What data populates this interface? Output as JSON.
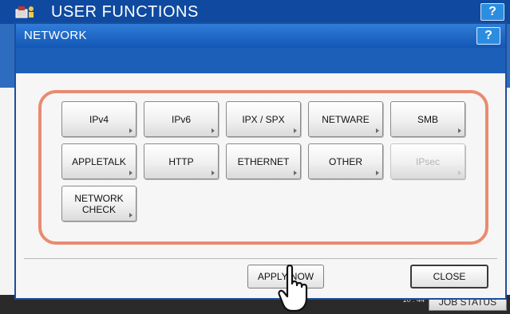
{
  "background": {
    "title": "USER FUNCTIONS",
    "help_label": "?",
    "time": "10 : 44",
    "job_status_label": "JOB STATUS"
  },
  "dialog": {
    "title": "NETWORK",
    "help_label": "?",
    "buttons": [
      {
        "label": "IPv4",
        "enabled": true
      },
      {
        "label": "IPv6",
        "enabled": true
      },
      {
        "label": "IPX / SPX",
        "enabled": true
      },
      {
        "label": "NETWARE",
        "enabled": true
      },
      {
        "label": "SMB",
        "enabled": true
      },
      {
        "label": "APPLETALK",
        "enabled": true
      },
      {
        "label": "HTTP",
        "enabled": true
      },
      {
        "label": "ETHERNET",
        "enabled": true
      },
      {
        "label": "OTHER",
        "enabled": true
      },
      {
        "label": "IPsec",
        "enabled": false
      },
      {
        "label": "NETWORK\nCHECK",
        "enabled": true
      }
    ],
    "apply_now_label": "APPLY NOW",
    "close_label": "CLOSE"
  },
  "colors": {
    "title_blue": "#1357b5",
    "group_frame": "#e98b70"
  }
}
